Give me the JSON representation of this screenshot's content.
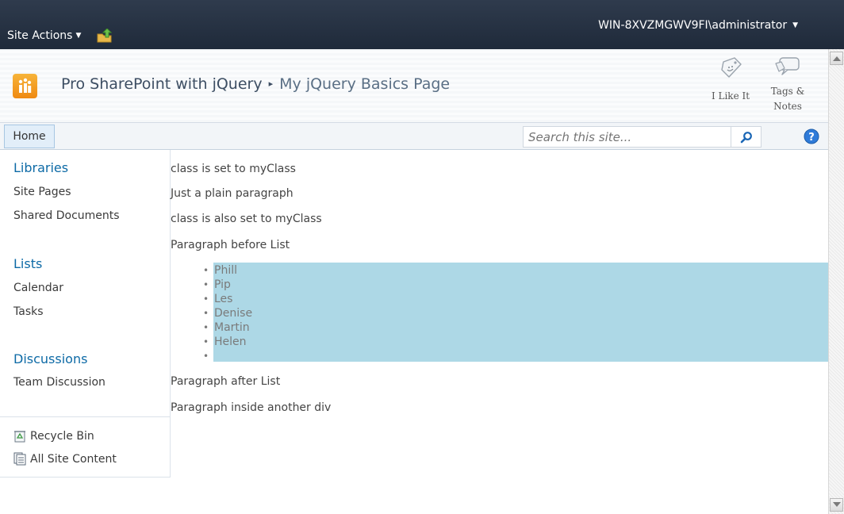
{
  "ribbon": {
    "site_actions_label": "Site Actions",
    "user_label": "WIN-8XVZMGWV9FI\\administrator"
  },
  "breadcrumb": {
    "site": "Pro SharePoint with jQuery",
    "separator": "▸",
    "page": "My jQuery Basics Page"
  },
  "social": {
    "like_label": "I Like It",
    "tags_label_line1": "Tags &",
    "tags_label_line2": "Notes"
  },
  "top_nav": {
    "home_tab": "Home",
    "search_placeholder": "Search this site..."
  },
  "left_nav": {
    "libraries_heading": "Libraries",
    "libraries": [
      "Site Pages",
      "Shared Documents"
    ],
    "lists_heading": "Lists",
    "lists": [
      "Calendar",
      "Tasks"
    ],
    "discussions_heading": "Discussions",
    "discussions": [
      "Team Discussion"
    ],
    "recycle_bin": "Recycle Bin",
    "all_site_content": "All Site Content"
  },
  "content": {
    "paragraphs_before": [
      "class is set to myClass",
      "Just a plain paragraph",
      "class is also set to myClass",
      "Paragraph before List"
    ],
    "list_items": [
      "Phill",
      "Pip",
      "Les",
      "Denise",
      "Martin",
      "Helen",
      ""
    ],
    "paragraphs_after": [
      "Paragraph after List",
      "Paragraph inside another div"
    ]
  },
  "colors": {
    "ribbon_bg": "#26313f",
    "nav_heading": "#0d6aa6",
    "list_highlight": "#add8e6",
    "logo_orange": "#f29a1f"
  },
  "icons": {
    "navigate_up": "navigate-up-icon",
    "like": "like-tag-icon",
    "tags": "tags-notes-icon",
    "search": "search-icon",
    "help": "help-icon",
    "recycle_bin": "recycle-bin-icon",
    "all_site_content": "all-site-content-icon"
  }
}
